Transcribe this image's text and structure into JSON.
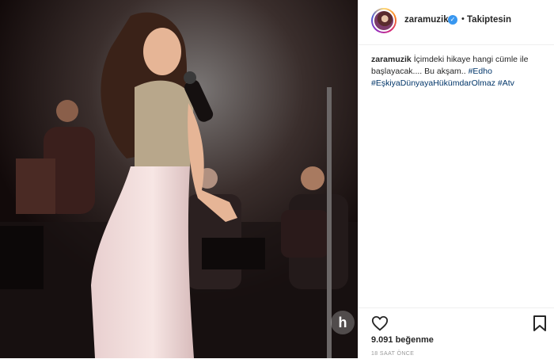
{
  "post": {
    "username": "zaramuzik",
    "follow_status": "Takiptesin",
    "caption_text": "İçimdeki hikaye hangi cümle ile başlayacak.... Bu akşam..",
    "hashtags": [
      "#Edho",
      "#EşkiyaDünyayaHükümdarOlmaz",
      "#Atv"
    ],
    "likes": "9.091 beğenme",
    "time_ago": "18 SAAT ÖNCE",
    "watermark": "h"
  },
  "icons": {
    "verified": "verified-check-icon",
    "like": "heart-icon",
    "save": "bookmark-icon"
  },
  "colors": {
    "verified": "#3897f0",
    "hashtag": "#003569",
    "text": "#262626"
  }
}
